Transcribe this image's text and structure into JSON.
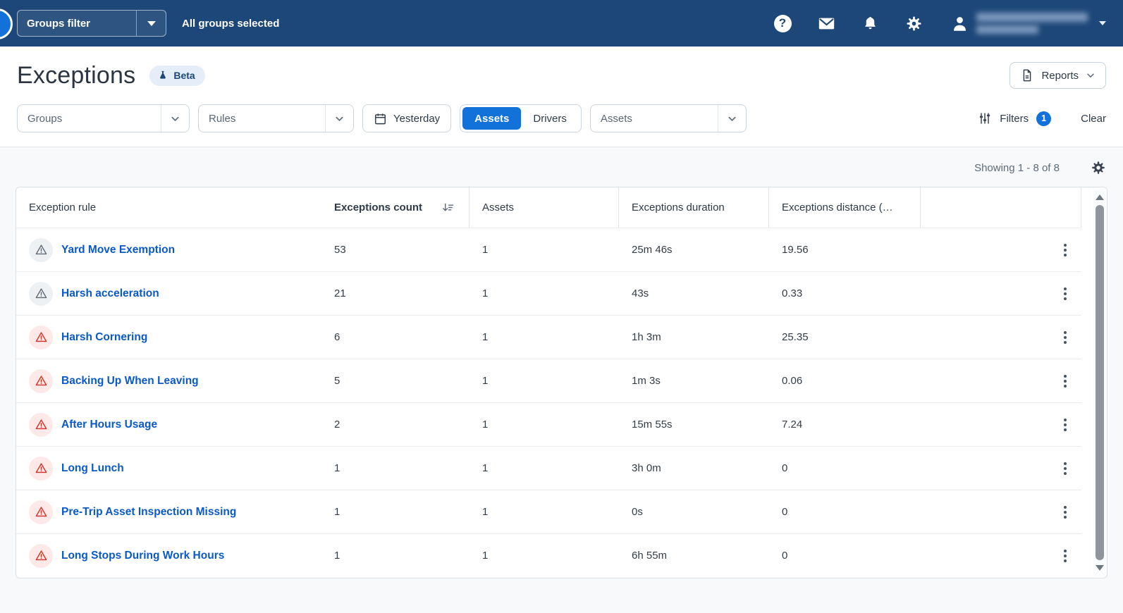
{
  "colors": {
    "topbar_bg": "#1d4778",
    "accent": "#1272d9",
    "link": "#0a59c9",
    "alert_red": "#d93025",
    "alert_red_bg": "#fce9e8",
    "neutral_icon": "#5f6b77",
    "neutral_icon_bg": "#eef1f3",
    "page_bg": "#f7f9fb",
    "card_border": "#d9e0e7",
    "row_border": "#e9edf0",
    "control_border": "#cdd6de",
    "text_primary": "#2e3a47",
    "text_secondary": "#5d6b7a",
    "beta_bg": "#e4edf8",
    "beta_text": "#1d4778"
  },
  "topbar": {
    "groups_filter_label": "Groups filter",
    "all_groups_text": "All groups selected",
    "help_glyph": "?",
    "user_text_redacted": true
  },
  "header": {
    "title": "Exceptions",
    "beta_label": "Beta",
    "reports_label": "Reports"
  },
  "filters": {
    "groups_label": "Groups",
    "rules_label": "Rules",
    "date_label": "Yesterday",
    "toggle": {
      "assets": "Assets",
      "drivers": "Drivers",
      "selected": "Assets"
    },
    "assets_select_label": "Assets",
    "filters_label": "Filters",
    "filters_count": "1",
    "clear_label": "Clear"
  },
  "results": {
    "showing_text": "Showing 1 - 8 of 8"
  },
  "table": {
    "columns": [
      "Exception rule",
      "Exceptions count",
      "Assets",
      "Exceptions duration",
      "Exceptions distance (…"
    ],
    "sort_column": "Exceptions count",
    "sort_direction": "descending",
    "rows": [
      {
        "name": "Yard Move Exemption",
        "count": "53",
        "assets": "1",
        "duration": "25m 46s",
        "distance": "19.56",
        "severity": "gray"
      },
      {
        "name": "Harsh acceleration",
        "count": "21",
        "assets": "1",
        "duration": "43s",
        "distance": "0.33",
        "severity": "gray"
      },
      {
        "name": "Harsh Cornering",
        "count": "6",
        "assets": "1",
        "duration": "1h 3m",
        "distance": "25.35",
        "severity": "red"
      },
      {
        "name": "Backing Up When Leaving",
        "count": "5",
        "assets": "1",
        "duration": "1m 3s",
        "distance": "0.06",
        "severity": "red"
      },
      {
        "name": "After Hours Usage",
        "count": "2",
        "assets": "1",
        "duration": "15m 55s",
        "distance": "7.24",
        "severity": "red"
      },
      {
        "name": "Long Lunch",
        "count": "1",
        "assets": "1",
        "duration": "3h 0m",
        "distance": "0",
        "severity": "red"
      },
      {
        "name": "Pre-Trip Asset Inspection Missing",
        "count": "1",
        "assets": "1",
        "duration": "0s",
        "distance": "0",
        "severity": "red"
      },
      {
        "name": "Long Stops During Work Hours",
        "count": "1",
        "assets": "1",
        "duration": "6h 55m",
        "distance": "0",
        "severity": "red"
      }
    ]
  }
}
